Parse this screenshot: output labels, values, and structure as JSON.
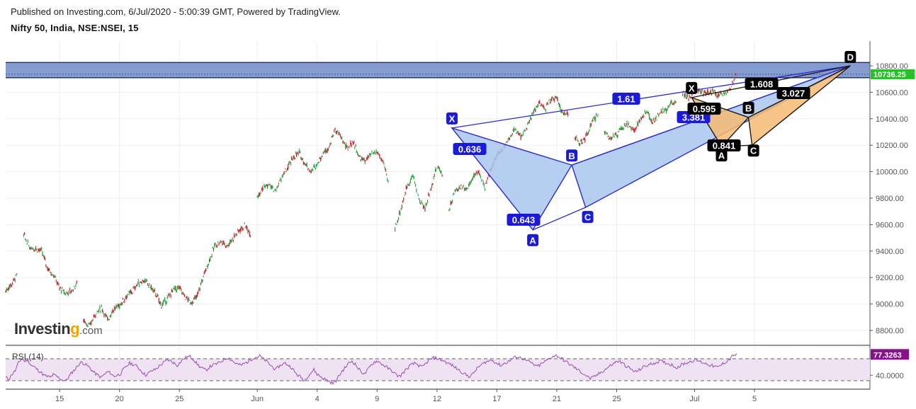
{
  "header": {
    "published": "Published on Investing.com, 6/Jul/2020 - 5:00:39 GMT, Powered by TradingView.",
    "symbol": "Nifty 50, India, NSE:NSEI, 15"
  },
  "logo": {
    "brand": "Investin",
    "dot_letter": "g",
    "suffix": ".com"
  },
  "colors": {
    "bull": "#26a641",
    "bear": "#c9202a",
    "blue_pattern_fill": "#a9c6ec",
    "blue_pattern_line": "#2b2bd0",
    "blue_label_bg": "#1a1adc",
    "orange_pattern_fill": "#f6bb72",
    "black_label_bg": "#000000",
    "zone_fill": "#7e97cf",
    "last_price_bg": "#22c322",
    "rsi_line": "#9b4fb0",
    "rsi_band": "#efe2f2",
    "rsi_value_bg": "#8a0f8a"
  },
  "chart_data": {
    "type": "candlestick",
    "title": "Nifty 50, India, NSE:NSEI, 15",
    "ylabel": "",
    "ylim": [
      8720,
      10950
    ],
    "price_ticks": [
      "10800.00",
      "10600.00",
      "10400.00",
      "10200.00",
      "10000.00",
      "9800.00",
      "9600.00",
      "9400.00",
      "9200.00",
      "9000.00",
      "8800.00"
    ],
    "price_tick_values": [
      10800,
      10600,
      10400,
      10200,
      10000,
      9800,
      9600,
      9400,
      9200,
      9000,
      8800
    ],
    "last_price": {
      "label": "10736.25",
      "value": 10736.25
    },
    "x_ticks": [
      "15",
      "20",
      "25",
      "Jun",
      "4",
      "9",
      "12",
      "17",
      "21",
      "25",
      "Jul",
      "5"
    ],
    "x_tick_index": [
      9,
      19,
      29,
      42,
      52,
      62,
      72,
      82,
      92,
      102,
      115,
      125
    ],
    "price_path": [
      [
        0,
        9100
      ],
      [
        1,
        9150
      ],
      [
        2,
        9230
      ],
      [
        3,
        9520
      ],
      [
        4,
        9430
      ],
      [
        5,
        9420
      ],
      [
        6,
        9400
      ],
      [
        7,
        9270
      ],
      [
        8,
        9220
      ],
      [
        9,
        9120
      ],
      [
        10,
        9080
      ],
      [
        11,
        9100
      ],
      [
        12,
        9160
      ],
      [
        13,
        8880
      ],
      [
        14,
        8830
      ],
      [
        15,
        8930
      ],
      [
        16,
        8970
      ],
      [
        17,
        8880
      ],
      [
        18,
        8960
      ],
      [
        19,
        8990
      ],
      [
        20,
        9050
      ],
      [
        21,
        9090
      ],
      [
        22,
        9150
      ],
      [
        23,
        9180
      ],
      [
        24,
        9140
      ],
      [
        25,
        9080
      ],
      [
        26,
        8990
      ],
      [
        27,
        9040
      ],
      [
        28,
        9110
      ],
      [
        29,
        9120
      ],
      [
        30,
        9050
      ],
      [
        31,
        9010
      ],
      [
        32,
        9060
      ],
      [
        33,
        9210
      ],
      [
        34,
        9330
      ],
      [
        35,
        9450
      ],
      [
        36,
        9470
      ],
      [
        37,
        9440
      ],
      [
        38,
        9500
      ],
      [
        39,
        9560
      ],
      [
        40,
        9590
      ],
      [
        41,
        9520
      ],
      [
        42,
        9820
      ],
      [
        43,
        9880
      ],
      [
        44,
        9900
      ],
      [
        45,
        9850
      ],
      [
        46,
        9950
      ],
      [
        47,
        10020
      ],
      [
        48,
        10110
      ],
      [
        49,
        10140
      ],
      [
        50,
        10060
      ],
      [
        51,
        10000
      ],
      [
        52,
        10060
      ],
      [
        53,
        10140
      ],
      [
        54,
        10190
      ],
      [
        55,
        10320
      ],
      [
        56,
        10260
      ],
      [
        57,
        10170
      ],
      [
        58,
        10230
      ],
      [
        59,
        10110
      ],
      [
        60,
        10080
      ],
      [
        61,
        10130
      ],
      [
        62,
        10150
      ],
      [
        63,
        10070
      ],
      [
        64,
        9900
      ],
      [
        65,
        9570
      ],
      [
        66,
        9720
      ],
      [
        67,
        9890
      ],
      [
        68,
        9970
      ],
      [
        69,
        9790
      ],
      [
        70,
        9720
      ],
      [
        71,
        9880
      ],
      [
        72,
        10040
      ],
      [
        73,
        9980
      ],
      [
        74,
        9710
      ],
      [
        75,
        9850
      ],
      [
        76,
        9890
      ],
      [
        77,
        9870
      ],
      [
        78,
        9960
      ],
      [
        79,
        10000
      ],
      [
        80,
        9870
      ],
      [
        81,
        10030
      ],
      [
        82,
        10120
      ],
      [
        83,
        10180
      ],
      [
        84,
        10250
      ],
      [
        85,
        10320
      ],
      [
        86,
        10270
      ],
      [
        87,
        10330
      ],
      [
        88,
        10440
      ],
      [
        89,
        10520
      ],
      [
        90,
        10470
      ],
      [
        91,
        10550
      ],
      [
        92,
        10560
      ],
      [
        93,
        10440
      ],
      [
        94,
        10430
      ],
      [
        95,
        10260
      ],
      [
        96,
        10210
      ],
      [
        97,
        10270
      ],
      [
        98,
        10380
      ],
      [
        99,
        10450
      ],
      [
        100,
        10290
      ],
      [
        101,
        10260
      ],
      [
        102,
        10280
      ],
      [
        103,
        10330
      ],
      [
        104,
        10360
      ],
      [
        105,
        10310
      ],
      [
        106,
        10400
      ],
      [
        107,
        10450
      ],
      [
        108,
        10370
      ],
      [
        109,
        10430
      ],
      [
        110,
        10460
      ],
      [
        111,
        10510
      ],
      [
        112,
        10540
      ],
      [
        113,
        10600
      ],
      [
        114,
        10560
      ],
      [
        115,
        10620
      ],
      [
        116,
        10610
      ],
      [
        117,
        10590
      ],
      [
        118,
        10610
      ],
      [
        119,
        10580
      ],
      [
        120,
        10600
      ],
      [
        121,
        10620
      ],
      [
        122,
        10740
      ]
    ],
    "resistance_zone": {
      "top": 10825,
      "bottom": 10710,
      "dotted_line": 10736.25
    },
    "patterns": [
      {
        "name": "blue-harmonic",
        "points": {
          "X": 10330,
          "A": 9560,
          "B": 10050,
          "C": 9730,
          "D": 10800
        },
        "point_index": {
          "X": 74.5,
          "A": 88.0,
          "B": 94.5,
          "C": 96.8,
          "D": 141.0
        },
        "ratios": [
          {
            "label": "0.636",
            "between": "XA-B"
          },
          {
            "label": "0.643",
            "between": "AB-C"
          },
          {
            "label": "1.61",
            "between": "XA-D"
          },
          {
            "label": "3.381",
            "between": "BC-D"
          }
        ]
      },
      {
        "name": "black-harmonic",
        "points": {
          "X": 10560,
          "A": 10190,
          "B": 10410,
          "C": 10200,
          "D": 10800
        },
        "point_index": {
          "X": 114.5,
          "A": 119.5,
          "B": 124.0,
          "C": 124.6,
          "D": 141.0
        },
        "ratios": [
          {
            "label": "0.595",
            "between": "XA-B"
          },
          {
            "label": "0.841",
            "between": "AB-C"
          },
          {
            "label": "1.608",
            "between": "XA-D"
          },
          {
            "label": "3.027",
            "between": "BC-D"
          }
        ]
      }
    ],
    "rsi": {
      "title": "RSI (14)",
      "value_label": "77.3263",
      "value": 77.33,
      "tick_label": "40.0000",
      "tick_value": 40,
      "upper_band": 70,
      "lower_band": 30,
      "ylim": [
        15,
        85
      ],
      "series": [
        36,
        33,
        42,
        48,
        62,
        70,
        66,
        68,
        58,
        55,
        50,
        46,
        40,
        38,
        36,
        41,
        38,
        34,
        31,
        30,
        38,
        46,
        52,
        60,
        64,
        60,
        56,
        50,
        44,
        40,
        36,
        41,
        46,
        44,
        38,
        40,
        42,
        50,
        56,
        62,
        60,
        57,
        52,
        46,
        40,
        44,
        48,
        50,
        55,
        60,
        64,
        68,
        66,
        62,
        58,
        64,
        70,
        73,
        74,
        70,
        62,
        56,
        52,
        49,
        54,
        58,
        60,
        62,
        66,
        70,
        72,
        68,
        63,
        60,
        58,
        61,
        64,
        68,
        72,
        73,
        75,
        70,
        66,
        60,
        55,
        50,
        56,
        60,
        62,
        58,
        54,
        45,
        40,
        36,
        30,
        38,
        44,
        50,
        42,
        38,
        34,
        31,
        28,
        25,
        30,
        40,
        48,
        55,
        62,
        66,
        60,
        52,
        46,
        42,
        50,
        58,
        64,
        66,
        62,
        58,
        54,
        50,
        46,
        40,
        38,
        44,
        50,
        56,
        60,
        62,
        58,
        54,
        60,
        66,
        70,
        72,
        70,
        68,
        66,
        62,
        60,
        56,
        52,
        48,
        44,
        40,
        38,
        42,
        50,
        56,
        60,
        64,
        66,
        68,
        64,
        60,
        58,
        62,
        64,
        68,
        72,
        74,
        72,
        70,
        66,
        64,
        60,
        56,
        58,
        62,
        66,
        70,
        74,
        76,
        74,
        70,
        66,
        62,
        58,
        54,
        50,
        46,
        42,
        38,
        34,
        36,
        40,
        44,
        48,
        52,
        56,
        60,
        64,
        66,
        62,
        58,
        54,
        50,
        46,
        48,
        52,
        56,
        58,
        60,
        62,
        64,
        66,
        64,
        62,
        60,
        58,
        54,
        56,
        60,
        62,
        64,
        66,
        68,
        66,
        64,
        62,
        60,
        58,
        56,
        54,
        58,
        62,
        66,
        70,
        77,
        77
      ]
    }
  }
}
